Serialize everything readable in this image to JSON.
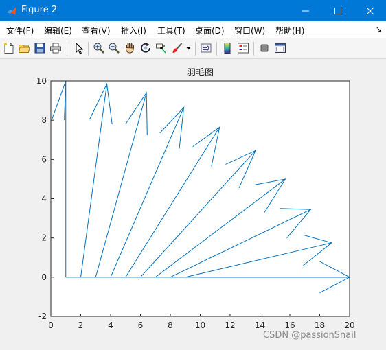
{
  "window": {
    "title": "Figure 2"
  },
  "menu": [
    {
      "label": "文件(F)"
    },
    {
      "label": "编辑(E)"
    },
    {
      "label": "查看(V)"
    },
    {
      "label": "插入(I)"
    },
    {
      "label": "工具(T)"
    },
    {
      "label": "桌面(D)"
    },
    {
      "label": "窗口(W)"
    },
    {
      "label": "帮助(H)"
    }
  ],
  "menu_corner_glyph": "↘",
  "toolbar_icons": [
    "new-figure-icon",
    "open-file-icon",
    "save-icon",
    "print-icon",
    "pointer-icon",
    "zoom-in-icon",
    "zoom-out-icon",
    "pan-hand-icon",
    "rotate-3d-icon",
    "data-cursor-icon",
    "brush-icon",
    "brush-dropdown-icon",
    "link-plot-icon",
    "colorbar-icon",
    "legend-icon",
    "hide-plot-tools-icon",
    "show-plot-tools-icon"
  ],
  "chart_data": {
    "type": "feather",
    "title": "羽毛图",
    "xlabel": "",
    "ylabel": "",
    "xlim": [
      0,
      20
    ],
    "ylim": [
      -2,
      10
    ],
    "xticks": [
      0,
      2,
      4,
      6,
      8,
      10,
      12,
      14,
      16,
      18,
      20
    ],
    "yticks": [
      -2,
      0,
      2,
      4,
      6,
      8,
      10
    ],
    "grid": false,
    "line_color": "#0072bd",
    "arrows": [
      {
        "x0": 1,
        "x1": 1,
        "y1": 10
      },
      {
        "x0": 2,
        "x1": 3.75,
        "y1": 9.85
      },
      {
        "x0": 3,
        "x1": 6.4,
        "y1": 9.4
      },
      {
        "x0": 4,
        "x1": 8.9,
        "y1": 8.65
      },
      {
        "x0": 5,
        "x1": 11.3,
        "y1": 7.65
      },
      {
        "x0": 6,
        "x1": 13.7,
        "y1": 6.45
      },
      {
        "x0": 7,
        "x1": 15.7,
        "y1": 5.0
      },
      {
        "x0": 8,
        "x1": 17.4,
        "y1": 3.45
      },
      {
        "x0": 9,
        "x1": 18.8,
        "y1": 1.75
      },
      {
        "x0": 10,
        "x1": 20,
        "y1": 0
      }
    ],
    "heads": [
      [
        [
          0.05,
          8.0
        ],
        [
          1,
          10
        ],
        [
          0.9,
          8.0
        ]
      ],
      [
        [
          2.6,
          8.05
        ],
        [
          3.75,
          9.85
        ],
        [
          4.1,
          7.8
        ]
      ],
      [
        [
          5.0,
          7.8
        ],
        [
          6.4,
          9.4
        ],
        [
          6.45,
          7.25
        ]
      ],
      [
        [
          7.3,
          7.35
        ],
        [
          8.9,
          8.65
        ],
        [
          8.6,
          6.55
        ]
      ],
      [
        [
          9.5,
          6.65
        ],
        [
          11.3,
          7.65
        ],
        [
          10.75,
          5.65
        ]
      ],
      [
        [
          11.7,
          5.75
        ],
        [
          13.7,
          6.45
        ],
        [
          12.6,
          4.55
        ]
      ],
      [
        [
          13.6,
          4.7
        ],
        [
          15.7,
          5.0
        ],
        [
          14.3,
          3.3
        ]
      ],
      [
        [
          15.35,
          3.5
        ],
        [
          17.4,
          3.45
        ],
        [
          15.8,
          2.0
        ]
      ],
      [
        [
          16.9,
          2.15
        ],
        [
          18.8,
          1.75
        ],
        [
          16.9,
          0.6
        ]
      ],
      [
        [
          18.0,
          0.8
        ],
        [
          20,
          0
        ],
        [
          18.0,
          -0.8
        ]
      ]
    ]
  },
  "watermark": "CSDN @passionSnail"
}
